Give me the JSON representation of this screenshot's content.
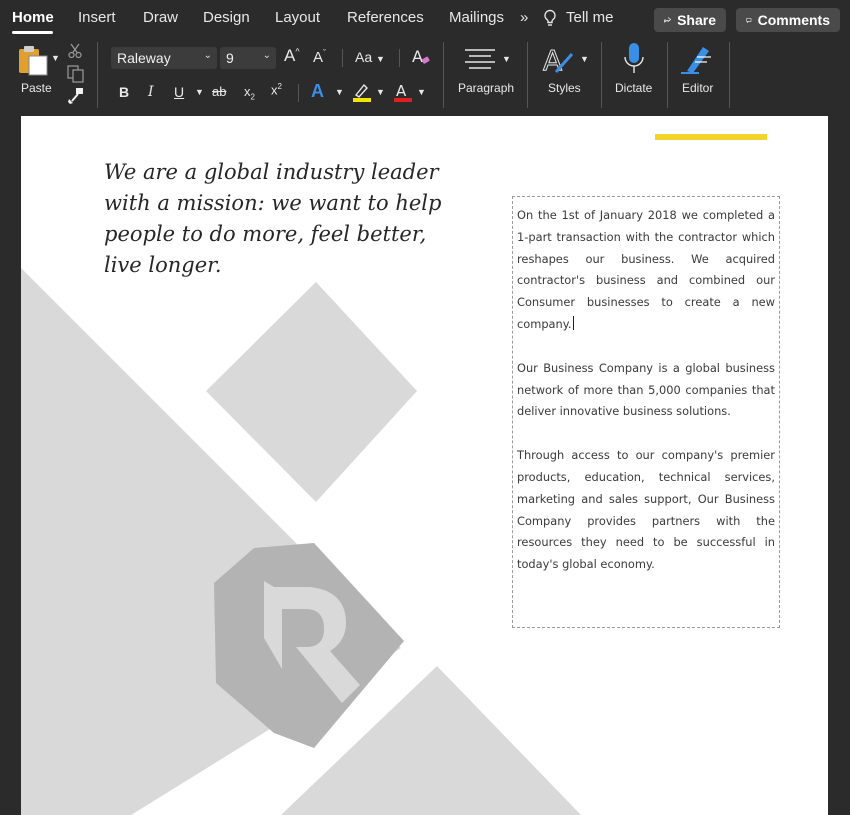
{
  "tabs": [
    {
      "label": "Home",
      "active": true
    },
    {
      "label": "Insert"
    },
    {
      "label": "Draw"
    },
    {
      "label": "Design"
    },
    {
      "label": "Layout"
    },
    {
      "label": "References"
    },
    {
      "label": "Mailings"
    }
  ],
  "tell_me": "Tell me",
  "share_label": "Share",
  "comments_label": "Comments",
  "ribbon": {
    "paste_label": "Paste",
    "font_name": "Raleway",
    "font_size": "9",
    "change_case": "Aa",
    "paragraph_label": "Paragraph",
    "styles_label": "Styles",
    "dictate_label": "Dictate",
    "editor_label": "Editor"
  },
  "document": {
    "headline": "We are a global industry leader with a mission: we want to help people to do more, feel better, live longer.",
    "paragraphs": [
      "On the 1st of January 2018 we completed a 1-part transaction with the contractor which reshapes our business. We acquired contractor's business and combined our Consumer businesses to create a new company.",
      "Our Business Company is a global business network of more than 5,000 companies that deliver innovative business solutions.",
      "Through access to our company's premier products, education, technical services, marketing and sales support, Our Business Company provides partners with the resources they need to be successful in today's global economy."
    ]
  },
  "colors": {
    "ribbon_bg": "#2b2b2b",
    "accent_yellow": "#f3d42a",
    "shape_gray": "#d9d9d9",
    "logo_gray": "#b3b3b3",
    "font_color_red": "#e02020",
    "highlight_yellow": "#f2e600",
    "text_effect_blue": "#3a8ee6"
  }
}
